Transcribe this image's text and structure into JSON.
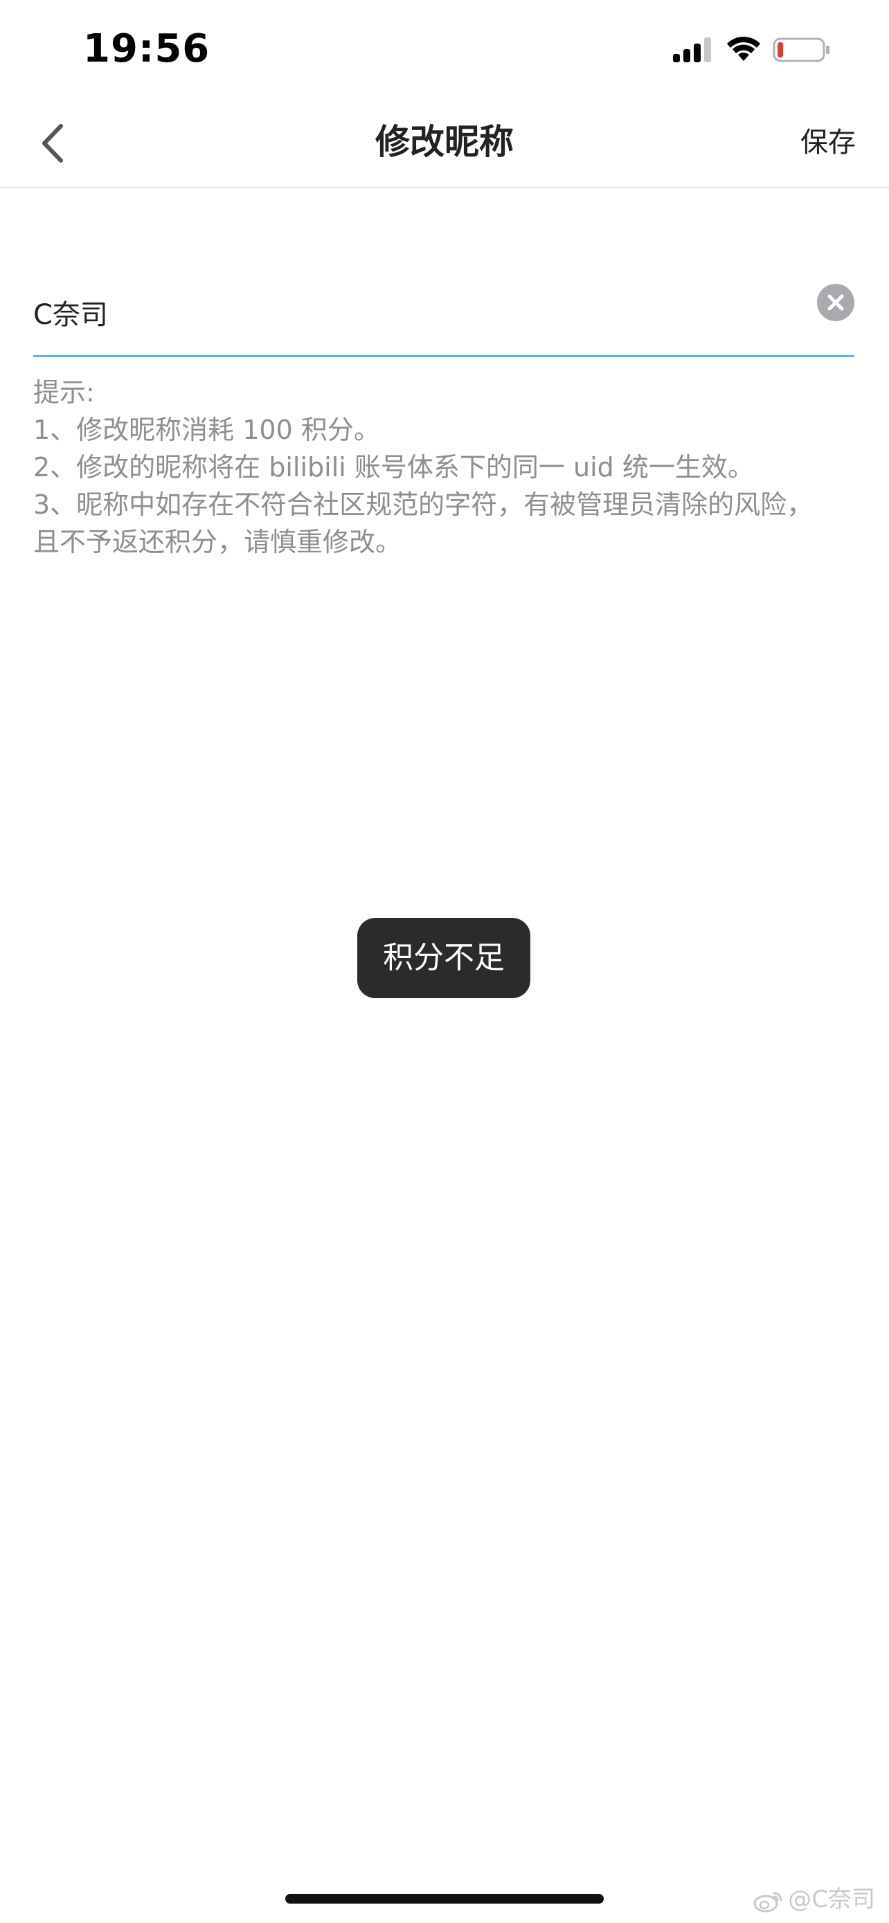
{
  "status_bar": {
    "time": "19:56"
  },
  "nav": {
    "title": "修改昵称",
    "save_label": "保存"
  },
  "nickname": {
    "value": "C奈司"
  },
  "hints": {
    "lines": [
      "提示:",
      "1、修改昵称消耗 100 积分。",
      "2、修改的昵称将在 bilibili 账号体系下的同一 uid 统一生效。",
      "3、昵称中如存在不符合社区规范的字符，有被管理员清除的风险，",
      "且不予返还积分，请慎重修改。"
    ]
  },
  "toast": {
    "message": "积分不足"
  },
  "watermark": {
    "text": "@C奈司"
  },
  "colors": {
    "accent_underline": "#52b7e8",
    "hint_text": "#8e8e93",
    "toast_bg": "#2b2b2b",
    "battery_low": "#e53935"
  },
  "icons": {
    "back": "chevron-left-icon",
    "clear": "close-circle-icon",
    "signal": "cellular-signal-icon",
    "wifi": "wifi-icon",
    "battery": "battery-icon",
    "watermark": "weibo-icon"
  }
}
